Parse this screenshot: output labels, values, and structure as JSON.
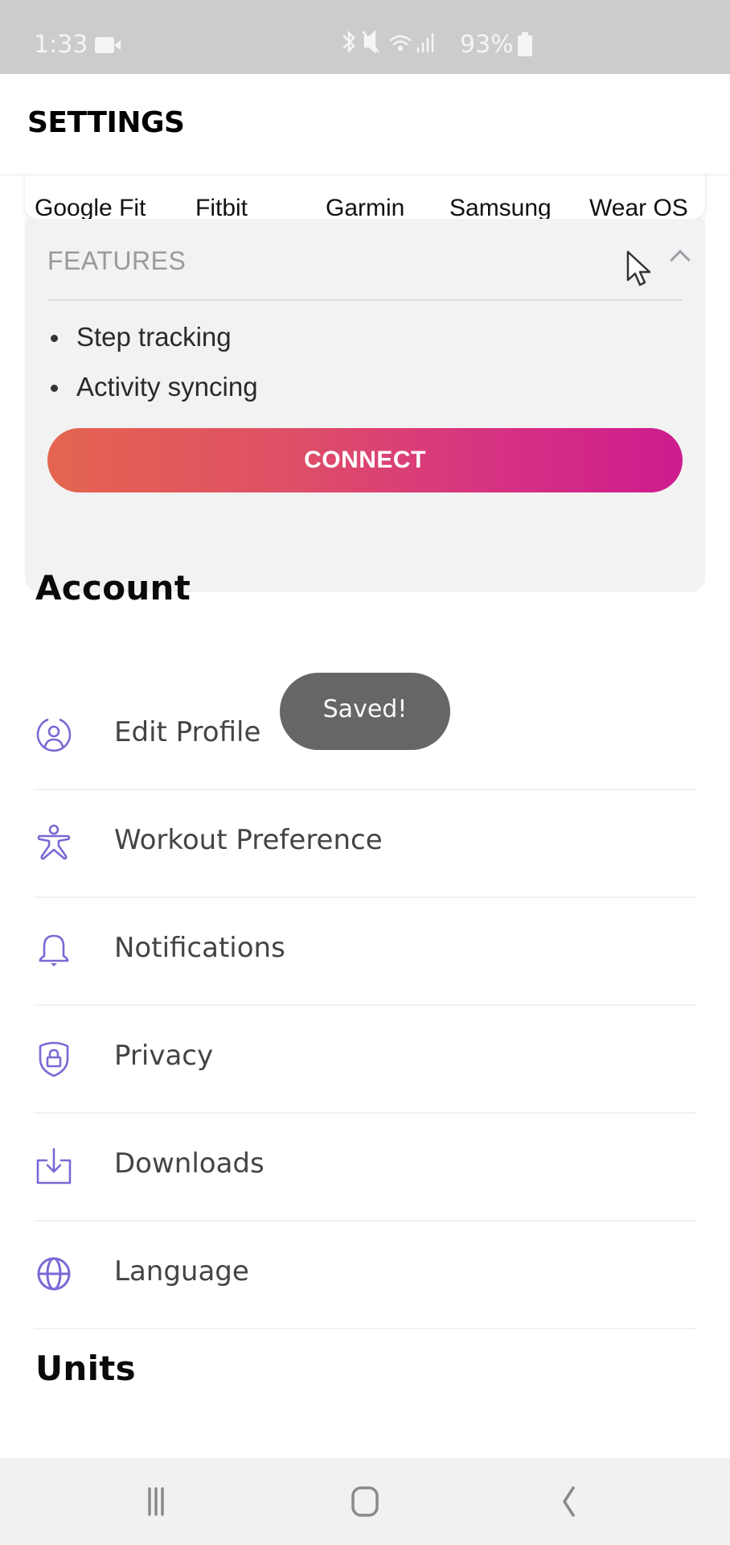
{
  "status_bar": {
    "time": "1:33",
    "system_icons": "✻ ✕ ≋",
    "battery_percent": "93%"
  },
  "header": {
    "title": "SETTINGS"
  },
  "device_tabs": {
    "items": [
      {
        "label": "Google Fit",
        "selected": true
      },
      {
        "label": "Fitbit",
        "selected": false
      },
      {
        "label": "Garmin",
        "selected": false
      },
      {
        "label": "Samsung",
        "selected": false
      },
      {
        "label": "Wear OS",
        "selected": false
      }
    ]
  },
  "features": {
    "title": "FEATURES",
    "expanded": true,
    "items": [
      "Step tracking",
      "Activity syncing"
    ],
    "connect_label": "CONNECT"
  },
  "account": {
    "heading": "Account",
    "items": [
      {
        "label": "Edit Profile",
        "icon": "user-circle-icon"
      },
      {
        "label": "Workout Preference",
        "icon": "person-exercise-icon"
      },
      {
        "label": "Notifications",
        "icon": "bell-icon"
      },
      {
        "label": "Privacy",
        "icon": "shield-lock-icon"
      },
      {
        "label": "Downloads",
        "icon": "download-tray-icon"
      },
      {
        "label": "Language",
        "icon": "globe-icon"
      }
    ]
  },
  "units": {
    "heading": "Units"
  },
  "toast": {
    "message": "Saved!"
  },
  "colors": {
    "accent_icon": "#7b68d4",
    "gradient_start": "#e5654f",
    "gradient_end": "#cd1c8f",
    "toast_bg": "#666666"
  }
}
